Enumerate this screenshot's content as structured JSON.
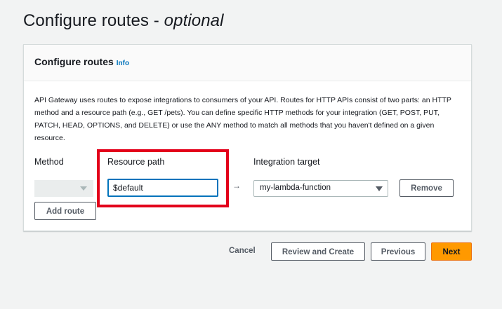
{
  "page": {
    "title_main": "Configure routes - ",
    "title_optional": "optional"
  },
  "panel": {
    "title": "Configure routes",
    "info_link": "Info",
    "description": "API Gateway uses routes to expose integrations to consumers of your API. Routes for HTTP APIs consist of two parts: an HTTP method and a resource path (e.g., GET /pets). You can define specific HTTP methods for your integration (GET, POST, PUT, PATCH, HEAD, OPTIONS, and DELETE) or use the ANY method to match all methods that you haven't defined on a given resource."
  },
  "route_form": {
    "method_label": "Method",
    "method_value": "",
    "resource_label": "Resource path",
    "resource_value": "$default",
    "arrow": "→",
    "target_label": "Integration target",
    "target_value": "my-lambda-function",
    "remove_label": "Remove",
    "add_route_label": "Add route"
  },
  "footer": {
    "cancel_label": "Cancel",
    "review_label": "Review and Create",
    "previous_label": "Previous",
    "next_label": "Next"
  },
  "colors": {
    "accent": "#0073bb",
    "primary_button": "#ff9900",
    "highlight": "#e3001b"
  },
  "icons": {
    "method_caret": "chevron-down-icon",
    "target_caret": "chevron-down-icon"
  }
}
